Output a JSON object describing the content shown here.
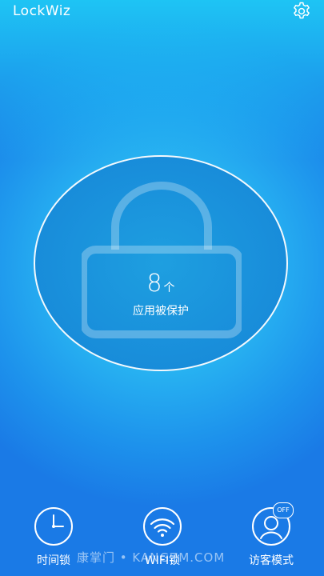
{
  "app": {
    "title": "LockWiz"
  },
  "status": {
    "protected_count": "8",
    "count_unit": "个",
    "caption": "应用被保护"
  },
  "nav": {
    "time_lock_label": "时间锁",
    "wifi_lock_label": "WIFI锁",
    "visitor_mode_label": "访客模式",
    "visitor_badge": "OFF"
  },
  "watermark": "康掌门 • KANGZM.COM",
  "colors": {
    "background_top": "#1ec4f4",
    "background_bottom": "#1a7ae6",
    "circle_fill": "#1e9fe0",
    "foreground": "#ffffff"
  },
  "icons": {
    "settings": "gear-icon",
    "lock": "padlock-icon",
    "time": "clock-icon",
    "wifi": "wifi-icon",
    "visitor": "person-icon"
  }
}
